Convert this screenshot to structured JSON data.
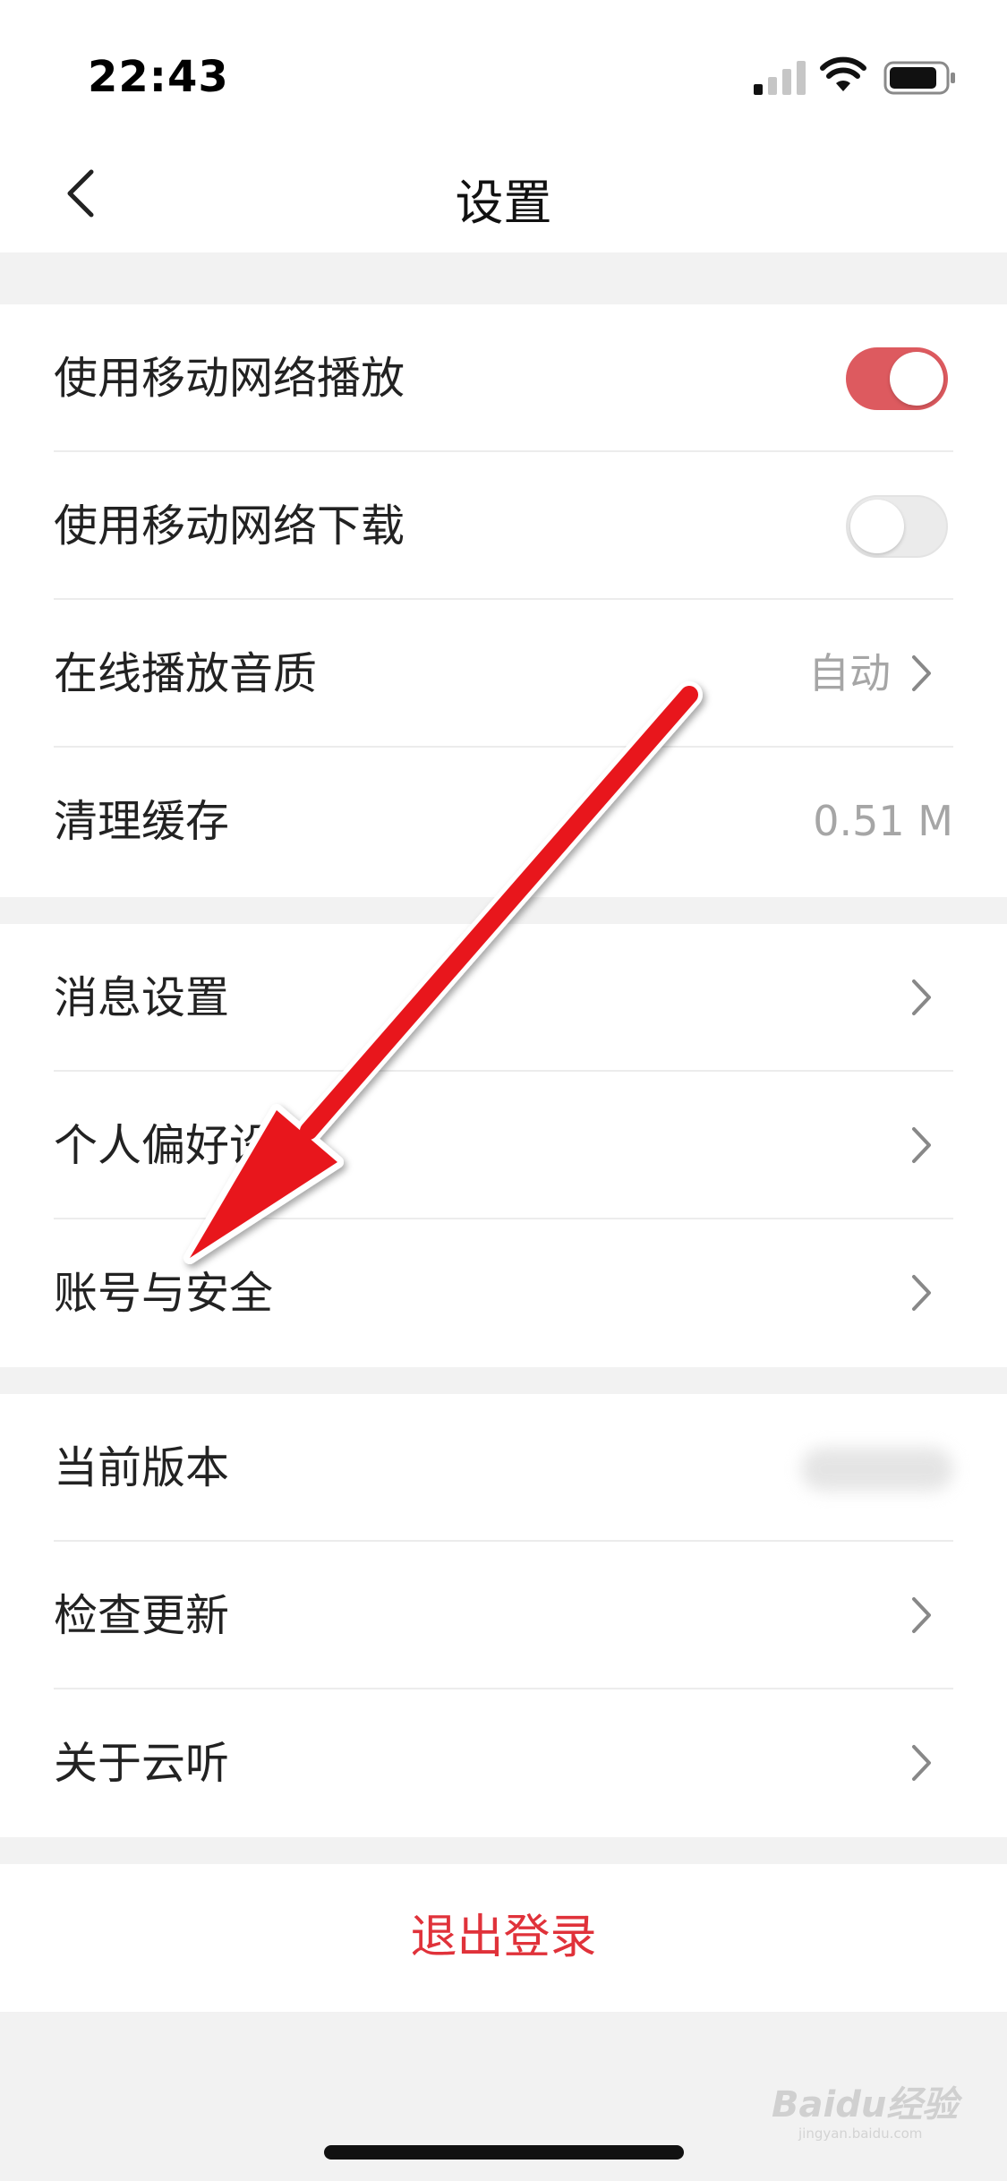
{
  "status_bar": {
    "time": "22:43",
    "icons": [
      "cellular-signal-icon",
      "wifi-icon",
      "battery-icon"
    ]
  },
  "nav": {
    "title": "设置",
    "back_icon": "chevron-left-icon"
  },
  "groups": [
    {
      "rows": [
        {
          "label": "使用移动网络播放",
          "control": "toggle",
          "on": true,
          "accent": "#dd5a5f"
        },
        {
          "label": "使用移动网络下载",
          "control": "toggle",
          "on": false
        },
        {
          "label": "在线播放音质",
          "value": "自动",
          "control": "chevron"
        },
        {
          "label": "清理缓存",
          "value": "0.51 M"
        }
      ]
    },
    {
      "rows": [
        {
          "label": "消息设置",
          "control": "chevron"
        },
        {
          "label": "个人偏好设置",
          "control": "chevron"
        },
        {
          "label": "账号与安全",
          "control": "chevron"
        }
      ]
    },
    {
      "rows": [
        {
          "label": "当前版本",
          "value_blurred": true
        },
        {
          "label": "检查更新",
          "control": "chevron"
        },
        {
          "label": "关于云听",
          "control": "chevron"
        }
      ]
    },
    {
      "rows": [
        {
          "label": "退出登录",
          "color": "#e0323a"
        }
      ]
    }
  ],
  "annotation": {
    "type": "arrow",
    "color": "#e8191f",
    "points_to": "账号与安全"
  },
  "watermark": {
    "brand": "Baidu经验",
    "url": "jingyan.baidu.com"
  }
}
